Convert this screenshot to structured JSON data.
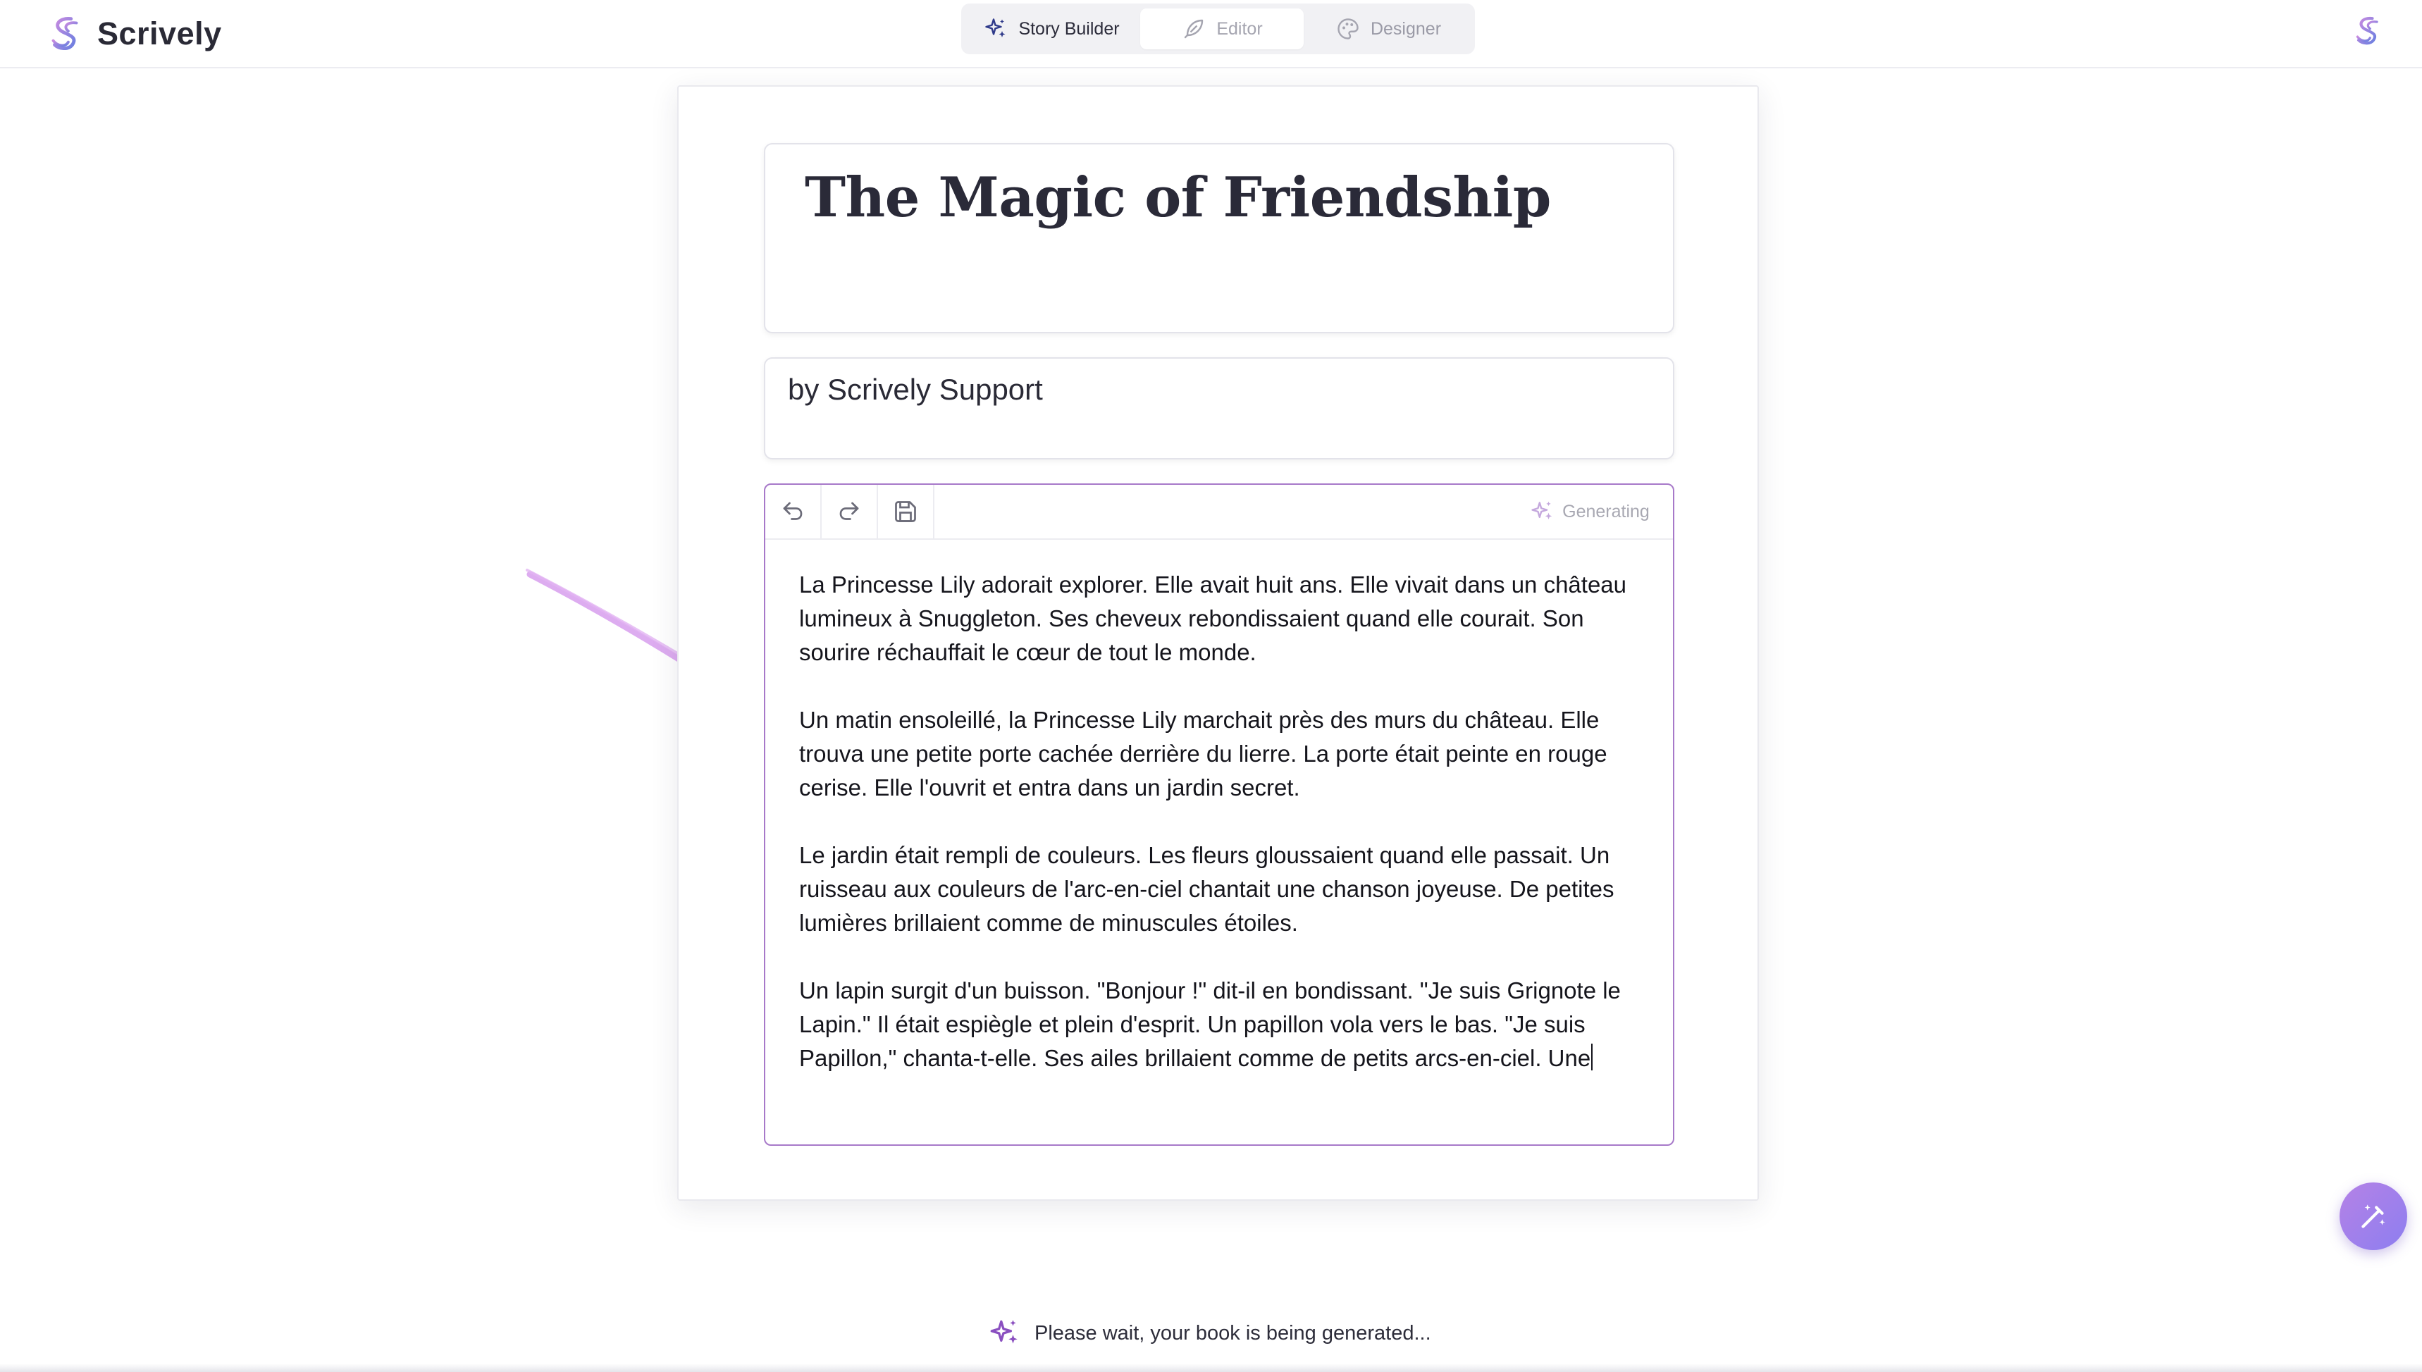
{
  "app": {
    "name": "Scrively"
  },
  "modes": [
    {
      "label": "Story Builder",
      "icon": "sparkles-icon",
      "state": "selected"
    },
    {
      "label": "Editor",
      "icon": "feather-icon",
      "state": "disabled"
    },
    {
      "label": "Designer",
      "icon": "palette-icon",
      "state": "disabled"
    }
  ],
  "book": {
    "title": "The Magic of Friendship",
    "author": "by Scrively Support"
  },
  "editor": {
    "toolbar": {
      "undo_icon": "undo-icon",
      "redo_icon": "redo-icon",
      "save_icon": "save-icon",
      "generating_label": "Generating"
    },
    "paragraphs": [
      "La Princesse Lily adorait explorer. Elle avait huit ans. Elle vivait dans un château lumineux à Snuggleton. Ses cheveux rebondissaient quand elle courait. Son sourire réchauffait le cœur de tout le monde.",
      "Un matin ensoleillé, la Princesse Lily marchait près des murs du château. Elle trouva une petite porte cachée derrière du lierre. La porte était peinte en rouge cerise. Elle l'ouvrit et entra dans un jardin secret.",
      "Le jardin était rempli de couleurs. Les fleurs gloussaient quand elle passait. Un ruisseau aux couleurs de l'arc-en-ciel chantait une chanson joyeuse. De petites lumières brillaient comme de minuscules étoiles.",
      "Un lapin surgit d'un buisson. \"Bonjour !\" dit-il en bondissant. \"Je suis Grignote le Lapin.\" Il était espiègle et plein d'esprit. Un papillon vola vers le bas. \"Je suis Papillon,\" chanta-t-elle. Ses ailes brillaient comme de petits arcs-en-ciel. Une"
    ]
  },
  "status": {
    "message": "Please wait, your book is being generated..."
  },
  "colors": {
    "accent": "#a779c9",
    "fab_gradient_start": "#b582e6",
    "fab_gradient_end": "#8d7ef0",
    "annotation_arrow": "#d9a3ee"
  }
}
